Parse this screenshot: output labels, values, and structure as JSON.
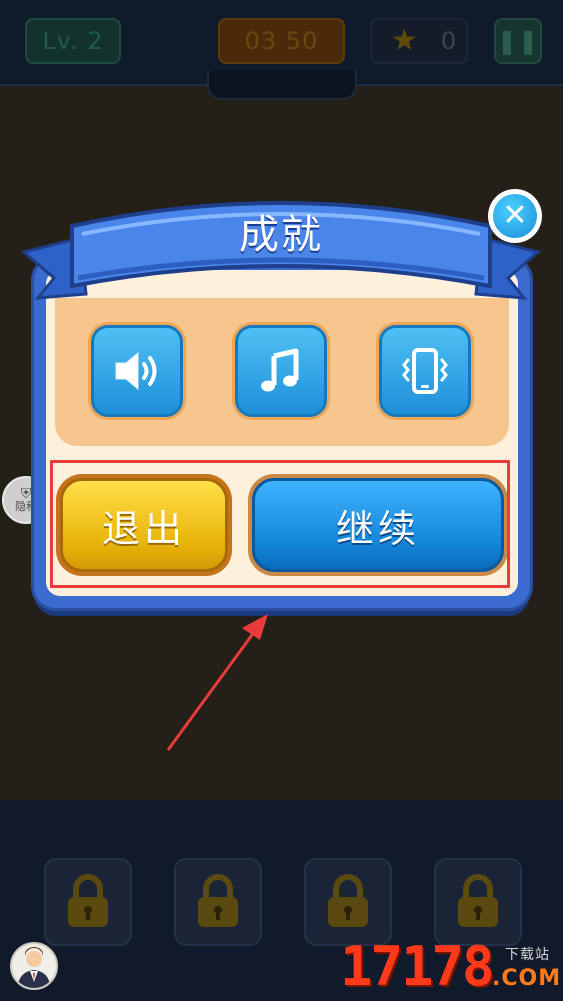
{
  "topbar": {
    "level": "Lv. 2",
    "timer": "03 50",
    "stars": "0",
    "pause_icon": "pause-icon"
  },
  "dialog": {
    "title": "成就",
    "icons": [
      "speaker-icon",
      "music-note-icon",
      "vibrate-icon"
    ],
    "exit_label": "退出",
    "continue_label": "继续",
    "close_icon": "close-icon"
  },
  "privacy": {
    "label": "隐私"
  },
  "bottom": {
    "locks": [
      "lock-icon",
      "lock-icon",
      "lock-icon",
      "lock-icon"
    ]
  },
  "watermark": {
    "brand": "17178",
    "sub": "下载站",
    "domain": ".COM"
  },
  "colors": {
    "dialog_blue": "#3c6bd0",
    "exit_yellow": "#f5c71a",
    "continue_blue": "#1a8fe0",
    "highlight_red": "#e83c3c"
  }
}
